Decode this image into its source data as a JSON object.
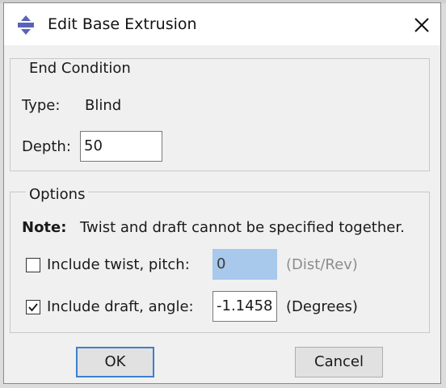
{
  "dialog": {
    "title": "Edit Base Extrusion",
    "icon": "extrude-icon",
    "close_icon": "close-icon"
  },
  "end_condition": {
    "group_label": "End Condition",
    "type_label": "Type:",
    "type_value": "Blind",
    "depth_label": "Depth:",
    "depth_value": "50"
  },
  "options": {
    "group_label": "Options",
    "note_label": "Note:",
    "note_text": "Twist and draft cannot be specified together.",
    "twist": {
      "label": "Include twist, pitch:",
      "checked": false,
      "value": "0",
      "unit": "(Dist/Rev)"
    },
    "draft": {
      "label": "Include draft, angle:",
      "checked": true,
      "value": "-1.1458",
      "unit": "(Degrees)"
    }
  },
  "buttons": {
    "ok": "OK",
    "cancel": "Cancel"
  },
  "colors": {
    "accent": "#3c7fd0",
    "disabled_field": "#a8c8ec"
  }
}
